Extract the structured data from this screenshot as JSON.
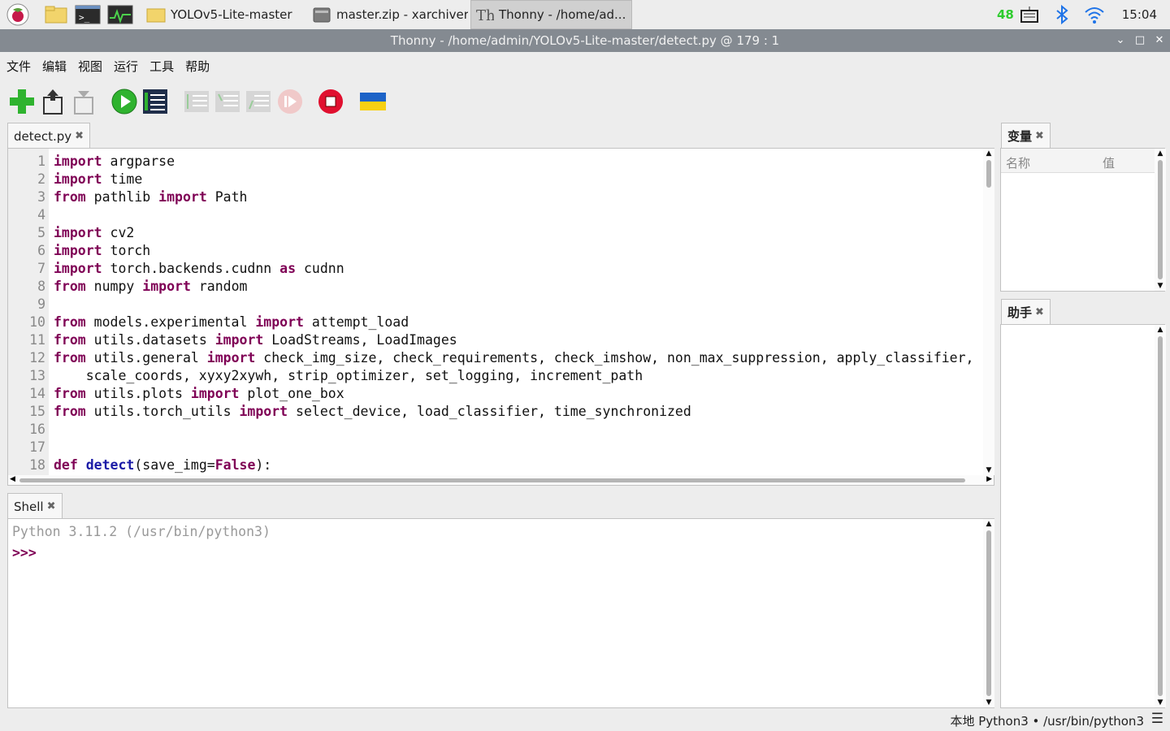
{
  "taskbar": {
    "tasks": [
      "YOLOv5-Lite-master",
      "master.zip - xarchiver...",
      "Thonny  -  /home/ad..."
    ],
    "cpu": "48",
    "clock": "15:04"
  },
  "window": {
    "title": "Thonny  -  /home/admin/YOLOv5-Lite-master/detect.py  @  179 : 1"
  },
  "menu": [
    "文件",
    "编辑",
    "视图",
    "运行",
    "工具",
    "帮助"
  ],
  "editor": {
    "tab": "detect.py",
    "line_numbers": [
      "1",
      "2",
      "3",
      "4",
      "5",
      "6",
      "7",
      "8",
      "9",
      "10",
      "11",
      "12",
      "13",
      "14",
      "15",
      "16",
      "17",
      "18"
    ]
  },
  "shell": {
    "tab": "Shell",
    "banner": "Python 3.11.2 (/usr/bin/python3)",
    "prompt": ">>>"
  },
  "variables": {
    "tab": "变量",
    "col_name": "名称",
    "col_value": "值"
  },
  "assistant": {
    "tab": "助手"
  },
  "status": {
    "text": "本地 Python3  •  /usr/bin/python3"
  },
  "colors": {
    "keyword": "#7f0055",
    "titlebar": "#848a91",
    "cpu": "#2ecc2e"
  }
}
